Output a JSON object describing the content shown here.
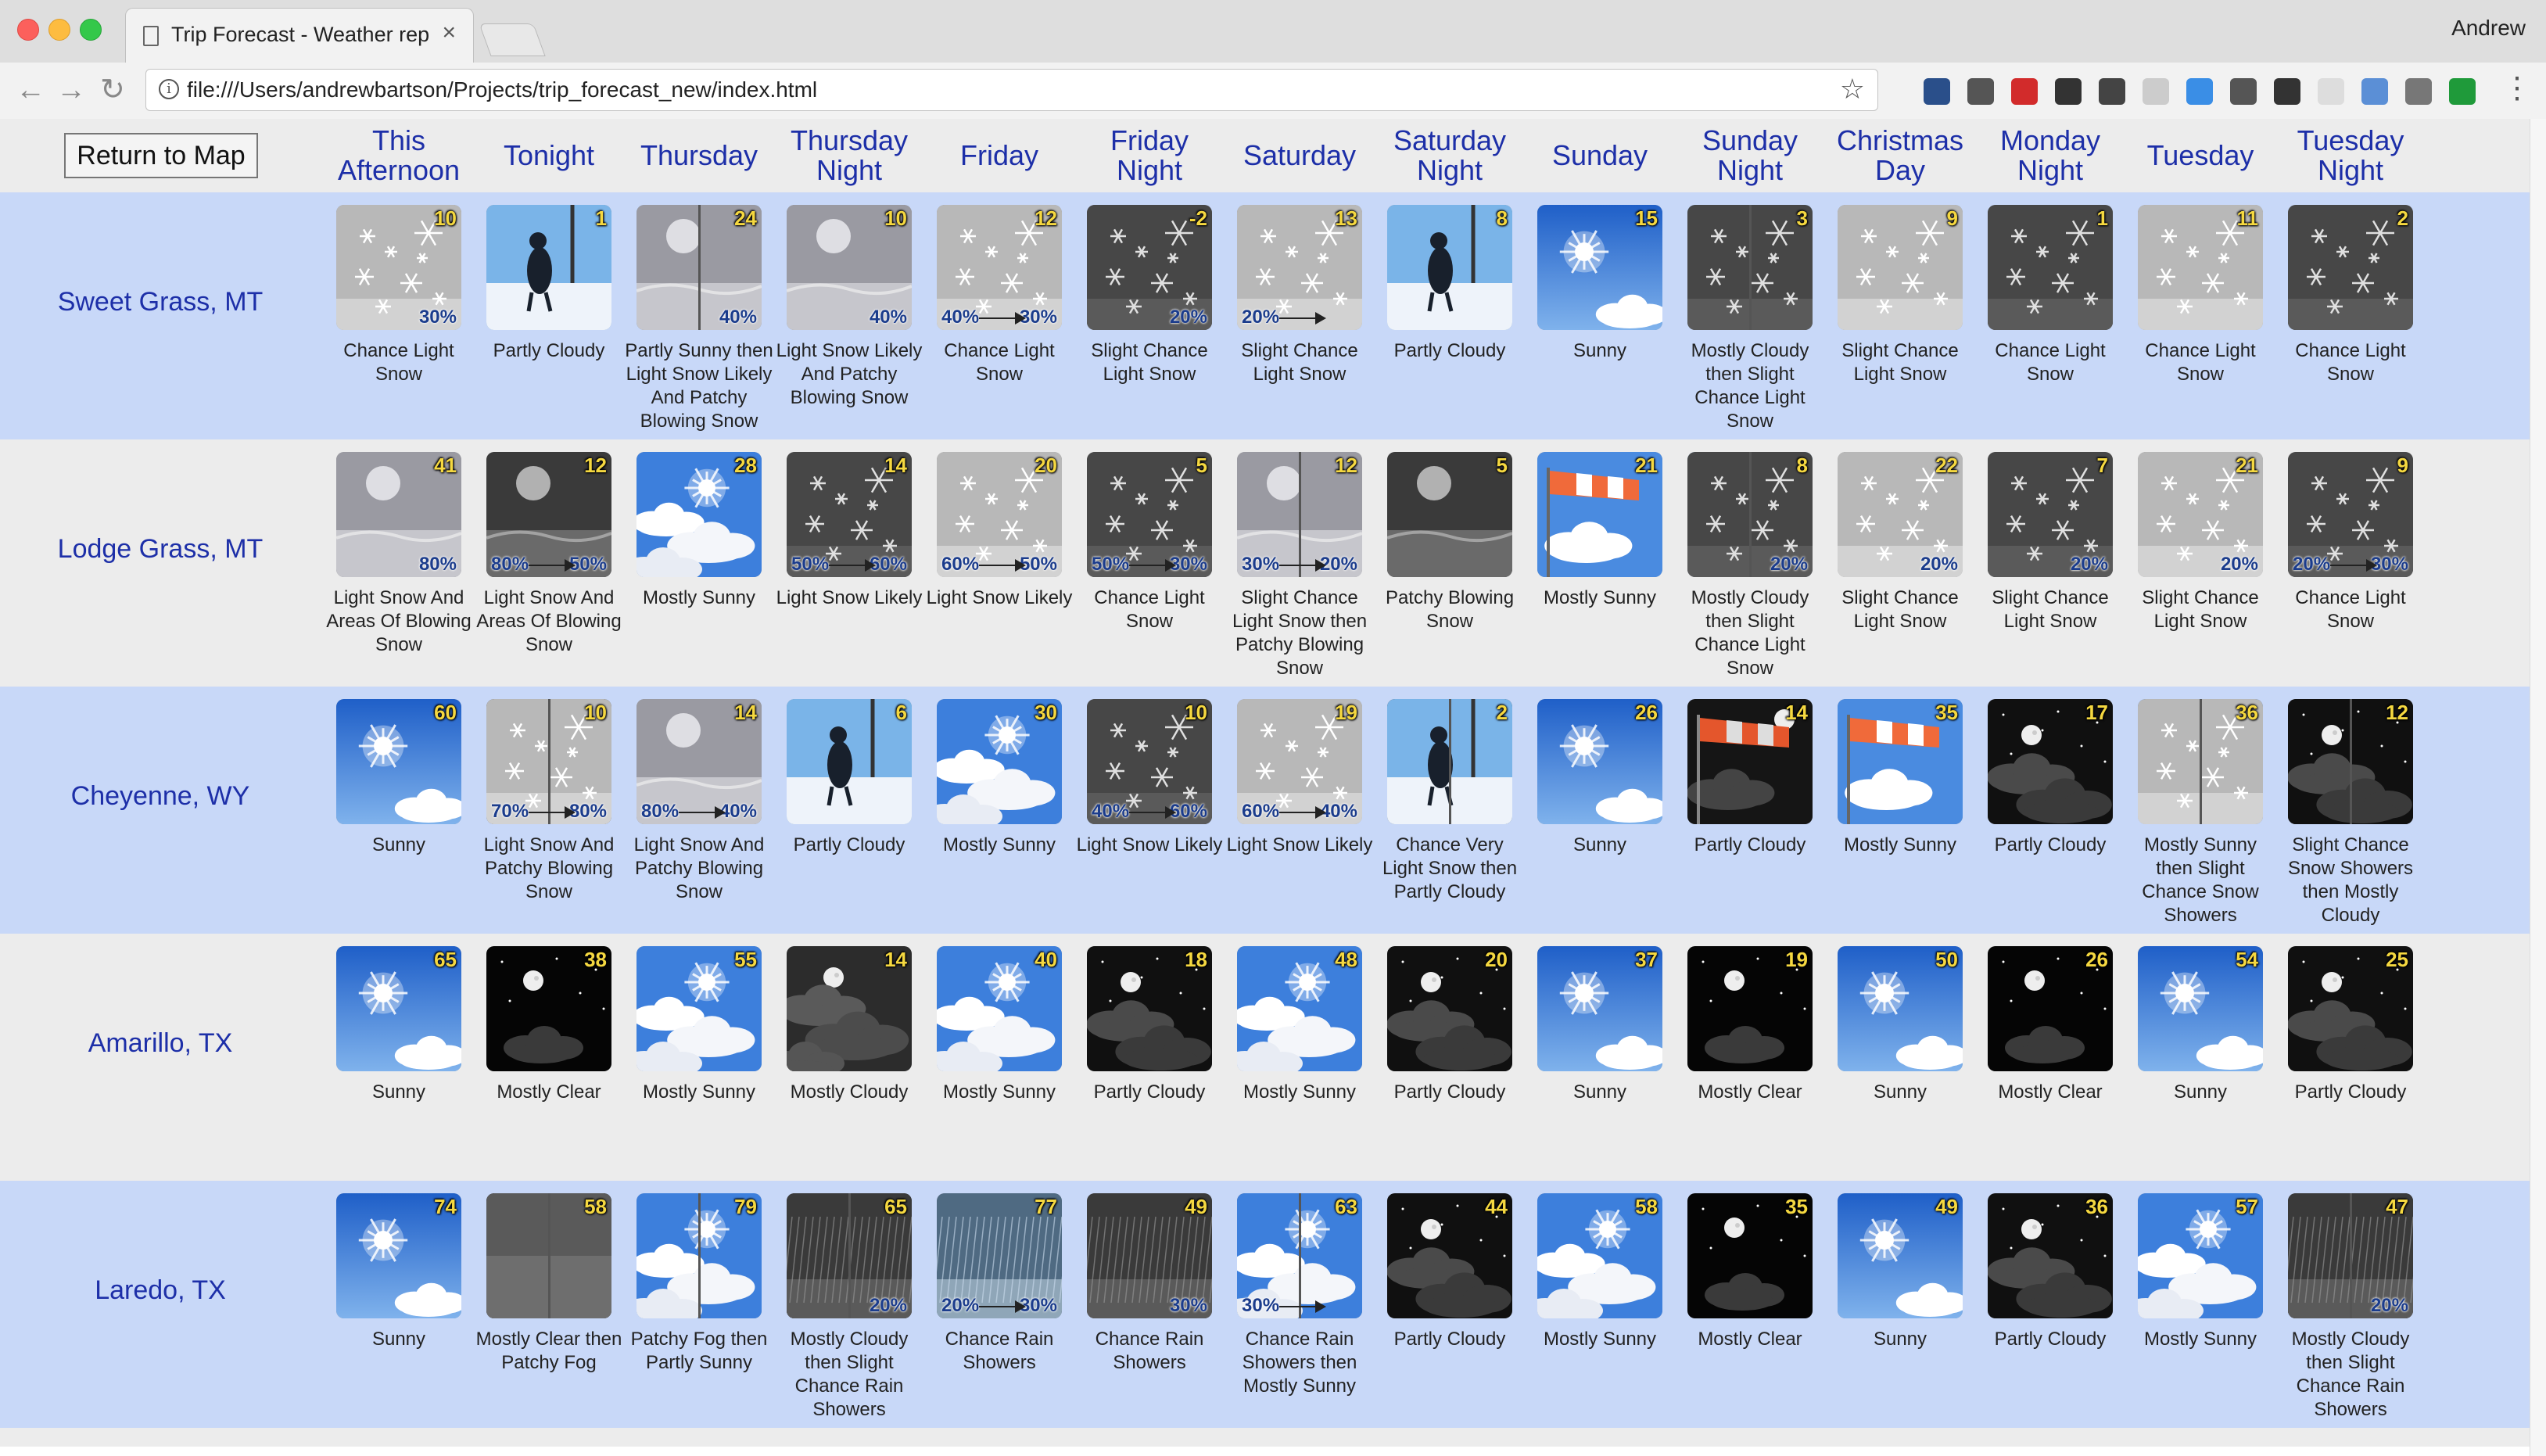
{
  "browser": {
    "tab_title": "Trip Forecast - Weather report",
    "tab_close": "×",
    "url": "file:///Users/andrewbartson/Projects/trip_forecast_new/index.html",
    "user": "Andrew",
    "back": "←",
    "forward": "→",
    "reload": "↻",
    "star": "☆",
    "menu": "⋮",
    "extensions": [
      {
        "icon": "bookmark-ext-icon",
        "color": "#2a4f8a"
      },
      {
        "icon": "jb-ext-icon",
        "color": "#555555"
      },
      {
        "icon": "adblock-ext-icon",
        "color": "#d22b2b"
      },
      {
        "icon": "clock-ext-icon",
        "color": "#333333"
      },
      {
        "icon": "evernote-ext-icon",
        "color": "#444444"
      },
      {
        "icon": "feather-ext-icon",
        "color": "#cccccc"
      },
      {
        "icon": "chrome-ext-icon",
        "color": "#3a8ee6"
      },
      {
        "icon": "mail-ext-icon",
        "color": "#555555"
      },
      {
        "icon": "grammarly-ext-icon",
        "color": "#333333"
      },
      {
        "icon": "blank-ext-icon",
        "color": "#dddddd"
      },
      {
        "icon": "calendar-ext-icon",
        "color": "#5b8fd6"
      },
      {
        "icon": "bug-ext-icon",
        "color": "#777777"
      },
      {
        "icon": "check-ext-icon",
        "color": "#1f9a3a"
      }
    ]
  },
  "page": {
    "return_button": "Return to Map",
    "days": [
      "This Afternoon",
      "Tonight",
      "Thursday",
      "Thursday Night",
      "Friday",
      "Friday Night",
      "Saturday",
      "Saturday Night",
      "Sunday",
      "Sunday Night",
      "Christmas Day",
      "Monday Night",
      "Tuesday",
      "Tuesday Night"
    ],
    "locations": [
      {
        "name": "Sweet Grass, MT",
        "forecasts": [
          {
            "desc": "Chance Light Snow",
            "temp": "10",
            "icons": [
              "snow"
            ],
            "pop": [
              "",
              "30%"
            ]
          },
          {
            "desc": "Partly Cloudy",
            "temp": "1",
            "icons": [
              "snowfig"
            ],
            "pop": []
          },
          {
            "desc": "Partly Sunny then Light Snow Likely And Patchy Blowing Snow",
            "temp": "24",
            "icons": [
              "clouds",
              "blowsnow"
            ],
            "pop": [
              "",
              "40%"
            ]
          },
          {
            "desc": "Light Snow Likely And Patchy Blowing Snow",
            "temp": "10",
            "icons": [
              "blowsnow"
            ],
            "pop": [
              "",
              "40%"
            ]
          },
          {
            "desc": "Chance Light Snow",
            "temp": "12",
            "icons": [
              "snow"
            ],
            "pop": [
              "40%",
              "30%"
            ]
          },
          {
            "desc": "Slight Chance Light Snow",
            "temp": "-2",
            "icons": [
              "nsnow"
            ],
            "pop": [
              "",
              "20%"
            ]
          },
          {
            "desc": "Slight Chance Light Snow",
            "temp": "13",
            "icons": [
              "snow"
            ],
            "pop": [
              "20%",
              ""
            ]
          },
          {
            "desc": "Partly Cloudy",
            "temp": "8",
            "icons": [
              "snowfig"
            ],
            "pop": []
          },
          {
            "desc": "Sunny",
            "temp": "15",
            "icons": [
              "sunny"
            ],
            "pop": []
          },
          {
            "desc": "Mostly Cloudy then Slight Chance Light Snow",
            "temp": "3",
            "icons": [
              "snowfig",
              "nsnow"
            ],
            "pop": []
          },
          {
            "desc": "Slight Chance Light Snow",
            "temp": "9",
            "icons": [
              "snow"
            ],
            "pop": []
          },
          {
            "desc": "Chance Light Snow",
            "temp": "1",
            "icons": [
              "nsnow"
            ],
            "pop": []
          },
          {
            "desc": "Chance Light Snow",
            "temp": "11",
            "icons": [
              "snow"
            ],
            "pop": []
          },
          {
            "desc": "Chance Light Snow",
            "temp": "2",
            "icons": [
              "nsnow"
            ],
            "pop": []
          }
        ]
      },
      {
        "name": "Lodge Grass, MT",
        "forecasts": [
          {
            "desc": "Light Snow And Areas Of Blowing Snow",
            "temp": "41",
            "icons": [
              "blowsnow"
            ],
            "pop": [
              "",
              "80%"
            ]
          },
          {
            "desc": "Light Snow And Areas Of Blowing Snow",
            "temp": "12",
            "icons": [
              "nblowsnow"
            ],
            "pop": [
              "80%",
              "50%"
            ]
          },
          {
            "desc": "Mostly Sunny",
            "temp": "28",
            "icons": [
              "msunny"
            ],
            "pop": []
          },
          {
            "desc": "Light Snow Likely",
            "temp": "14",
            "icons": [
              "nsnow"
            ],
            "pop": [
              "50%",
              "60%"
            ]
          },
          {
            "desc": "Light Snow Likely",
            "temp": "20",
            "icons": [
              "snow"
            ],
            "pop": [
              "60%",
              "50%"
            ]
          },
          {
            "desc": "Chance Light Snow",
            "temp": "5",
            "icons": [
              "nsnow"
            ],
            "pop": [
              "50%",
              "30%"
            ]
          },
          {
            "desc": "Slight Chance Light Snow then Patchy Blowing Snow",
            "temp": "12",
            "icons": [
              "snow",
              "blowsnow"
            ],
            "pop": [
              "30%",
              "20%"
            ]
          },
          {
            "desc": "Patchy Blowing Snow",
            "temp": "5",
            "icons": [
              "nblowsnow"
            ],
            "pop": []
          },
          {
            "desc": "Mostly Sunny",
            "temp": "21",
            "icons": [
              "windy"
            ],
            "pop": []
          },
          {
            "desc": "Mostly Cloudy then Slight Chance Light Snow",
            "temp": "8",
            "icons": [
              "snowfig",
              "nsnow"
            ],
            "pop": [
              "",
              "20%"
            ]
          },
          {
            "desc": "Slight Chance Light Snow",
            "temp": "22",
            "icons": [
              "snow"
            ],
            "pop": [
              "",
              "20%"
            ]
          },
          {
            "desc": "Slight Chance Light Snow",
            "temp": "7",
            "icons": [
              "nsnow"
            ],
            "pop": [
              "",
              "20%"
            ]
          },
          {
            "desc": "Slight Chance Light Snow",
            "temp": "21",
            "icons": [
              "snow"
            ],
            "pop": [
              "",
              "20%"
            ]
          },
          {
            "desc": "Chance Light Snow",
            "temp": "9",
            "icons": [
              "nsnow"
            ],
            "pop": [
              "20%",
              "30%"
            ]
          }
        ]
      },
      {
        "name": "Cheyenne, WY",
        "forecasts": [
          {
            "desc": "Sunny",
            "temp": "60",
            "icons": [
              "sunny"
            ],
            "pop": []
          },
          {
            "desc": "Light Snow And Patchy Blowing Snow",
            "temp": "10",
            "icons": [
              "nsnow",
              "snow"
            ],
            "pop": [
              "70%",
              "80%"
            ]
          },
          {
            "desc": "Light Snow And Patchy Blowing Snow",
            "temp": "14",
            "icons": [
              "blowsnow"
            ],
            "pop": [
              "80%",
              "40%"
            ]
          },
          {
            "desc": "Partly Cloudy",
            "temp": "6",
            "icons": [
              "snowfig"
            ],
            "pop": []
          },
          {
            "desc": "Mostly Sunny",
            "temp": "30",
            "icons": [
              "msunny"
            ],
            "pop": []
          },
          {
            "desc": "Light Snow Likely",
            "temp": "10",
            "icons": [
              "nsnow"
            ],
            "pop": [
              "40%",
              "60%"
            ]
          },
          {
            "desc": "Light Snow Likely",
            "temp": "19",
            "icons": [
              "snow"
            ],
            "pop": [
              "60%",
              "40%"
            ]
          },
          {
            "desc": "Chance Very Light Snow then Partly Cloudy",
            "temp": "2",
            "icons": [
              "nsnow",
              "snowfig"
            ],
            "pop": []
          },
          {
            "desc": "Sunny",
            "temp": "26",
            "icons": [
              "sunny"
            ],
            "pop": []
          },
          {
            "desc": "Partly Cloudy",
            "temp": "14",
            "icons": [
              "nwindy"
            ],
            "pop": []
          },
          {
            "desc": "Mostly Sunny",
            "temp": "35",
            "icons": [
              "windy"
            ],
            "pop": []
          },
          {
            "desc": "Partly Cloudy",
            "temp": "17",
            "icons": [
              "ncloudy"
            ],
            "pop": []
          },
          {
            "desc": "Mostly Sunny then Slight Chance Snow Showers",
            "temp": "36",
            "icons": [
              "msunny",
              "snow"
            ],
            "pop": []
          },
          {
            "desc": "Slight Chance Snow Showers then Mostly Cloudy",
            "temp": "12",
            "icons": [
              "nsnow",
              "ncloudy"
            ],
            "pop": []
          }
        ]
      },
      {
        "name": "Amarillo, TX",
        "forecasts": [
          {
            "desc": "Sunny",
            "temp": "65",
            "icons": [
              "sunny"
            ],
            "pop": []
          },
          {
            "desc": "Mostly Clear",
            "temp": "38",
            "icons": [
              "nclear"
            ],
            "pop": []
          },
          {
            "desc": "Mostly Sunny",
            "temp": "55",
            "icons": [
              "msunny"
            ],
            "pop": []
          },
          {
            "desc": "Mostly Cloudy",
            "temp": "14",
            "icons": [
              "nmcloudy"
            ],
            "pop": []
          },
          {
            "desc": "Mostly Sunny",
            "temp": "40",
            "icons": [
              "msunny"
            ],
            "pop": []
          },
          {
            "desc": "Partly Cloudy",
            "temp": "18",
            "icons": [
              "ncloudy"
            ],
            "pop": []
          },
          {
            "desc": "Mostly Sunny",
            "temp": "48",
            "icons": [
              "msunny"
            ],
            "pop": []
          },
          {
            "desc": "Partly Cloudy",
            "temp": "20",
            "icons": [
              "ncloudy"
            ],
            "pop": []
          },
          {
            "desc": "Sunny",
            "temp": "37",
            "icons": [
              "sunny"
            ],
            "pop": []
          },
          {
            "desc": "Mostly Clear",
            "temp": "19",
            "icons": [
              "nclear"
            ],
            "pop": []
          },
          {
            "desc": "Sunny",
            "temp": "50",
            "icons": [
              "sunny"
            ],
            "pop": []
          },
          {
            "desc": "Mostly Clear",
            "temp": "26",
            "icons": [
              "nclear"
            ],
            "pop": []
          },
          {
            "desc": "Sunny",
            "temp": "54",
            "icons": [
              "sunny"
            ],
            "pop": []
          },
          {
            "desc": "Partly Cloudy",
            "temp": "25",
            "icons": [
              "ncloudy"
            ],
            "pop": []
          }
        ]
      },
      {
        "name": "Laredo, TX",
        "forecasts": [
          {
            "desc": "Sunny",
            "temp": "74",
            "icons": [
              "sunny"
            ],
            "pop": []
          },
          {
            "desc": "Mostly Clear then Patchy Fog",
            "temp": "58",
            "icons": [
              "nclear",
              "nfog"
            ],
            "pop": []
          },
          {
            "desc": "Patchy Fog then Partly Sunny",
            "temp": "79",
            "icons": [
              "fog",
              "msunny"
            ],
            "pop": []
          },
          {
            "desc": "Mostly Cloudy then Slight Chance Rain Showers",
            "temp": "65",
            "icons": [
              "nmcloudy",
              "nrain"
            ],
            "pop": [
              "",
              "20%"
            ]
          },
          {
            "desc": "Chance Rain Showers",
            "temp": "77",
            "icons": [
              "rain"
            ],
            "pop": [
              "20%",
              "30%"
            ]
          },
          {
            "desc": "Chance Rain Showers",
            "temp": "49",
            "icons": [
              "nrain"
            ],
            "pop": [
              "",
              "30%"
            ]
          },
          {
            "desc": "Chance Rain Showers then Mostly Sunny",
            "temp": "63",
            "icons": [
              "rain",
              "msunny"
            ],
            "pop": [
              "30%",
              ""
            ]
          },
          {
            "desc": "Partly Cloudy",
            "temp": "44",
            "icons": [
              "ncloudy"
            ],
            "pop": []
          },
          {
            "desc": "Mostly Sunny",
            "temp": "58",
            "icons": [
              "msunny"
            ],
            "pop": []
          },
          {
            "desc": "Mostly Clear",
            "temp": "35",
            "icons": [
              "nclear"
            ],
            "pop": []
          },
          {
            "desc": "Sunny",
            "temp": "49",
            "icons": [
              "sunny"
            ],
            "pop": []
          },
          {
            "desc": "Partly Cloudy",
            "temp": "36",
            "icons": [
              "ncloudy"
            ],
            "pop": []
          },
          {
            "desc": "Mostly Sunny",
            "temp": "57",
            "icons": [
              "msunny"
            ],
            "pop": []
          },
          {
            "desc": "Mostly Cloudy then Slight Chance Rain Showers",
            "temp": "47",
            "icons": [
              "nmcloudy",
              "nrain"
            ],
            "pop": [
              "",
              "20%"
            ]
          }
        ]
      }
    ]
  }
}
